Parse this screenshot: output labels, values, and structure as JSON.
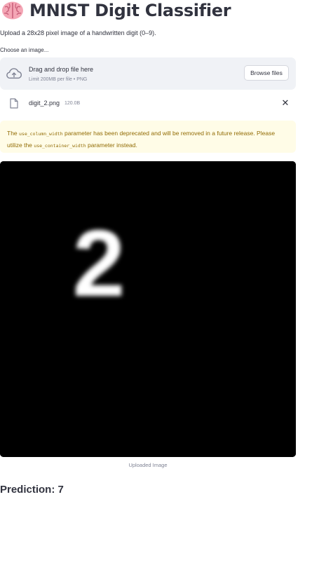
{
  "header": {
    "title": "MNIST Digit Classifier",
    "icon": "brain-icon"
  },
  "intro": {
    "text": "Upload a 28x28 pixel image of a handwritten digit (0–9)."
  },
  "uploader": {
    "label": "Choose an image...",
    "drop_title": "Drag and drop file here",
    "drop_limit": "Limit 200MB per file • PNG",
    "browse_label": "Browse files",
    "cloud_icon": "cloud-upload-icon"
  },
  "file": {
    "name": "digit_2.png",
    "size": "120.0B",
    "remove_icon": "close-icon"
  },
  "warning": {
    "part1": "The ",
    "code1": "use_column_width",
    "part2": " parameter has been deprecated and will be removed in a future release. Please utilize the ",
    "code2": "use_container_width",
    "part3": " parameter instead."
  },
  "image": {
    "caption": "Uploaded Image",
    "digit_shown": "2"
  },
  "result": {
    "prediction": "Prediction: 7"
  },
  "colors": {
    "text": "#31333f",
    "muted": "#808495",
    "dropzone_bg": "#f0f2f6",
    "warning_bg": "#fffce7",
    "warning_text": "#926c05"
  }
}
